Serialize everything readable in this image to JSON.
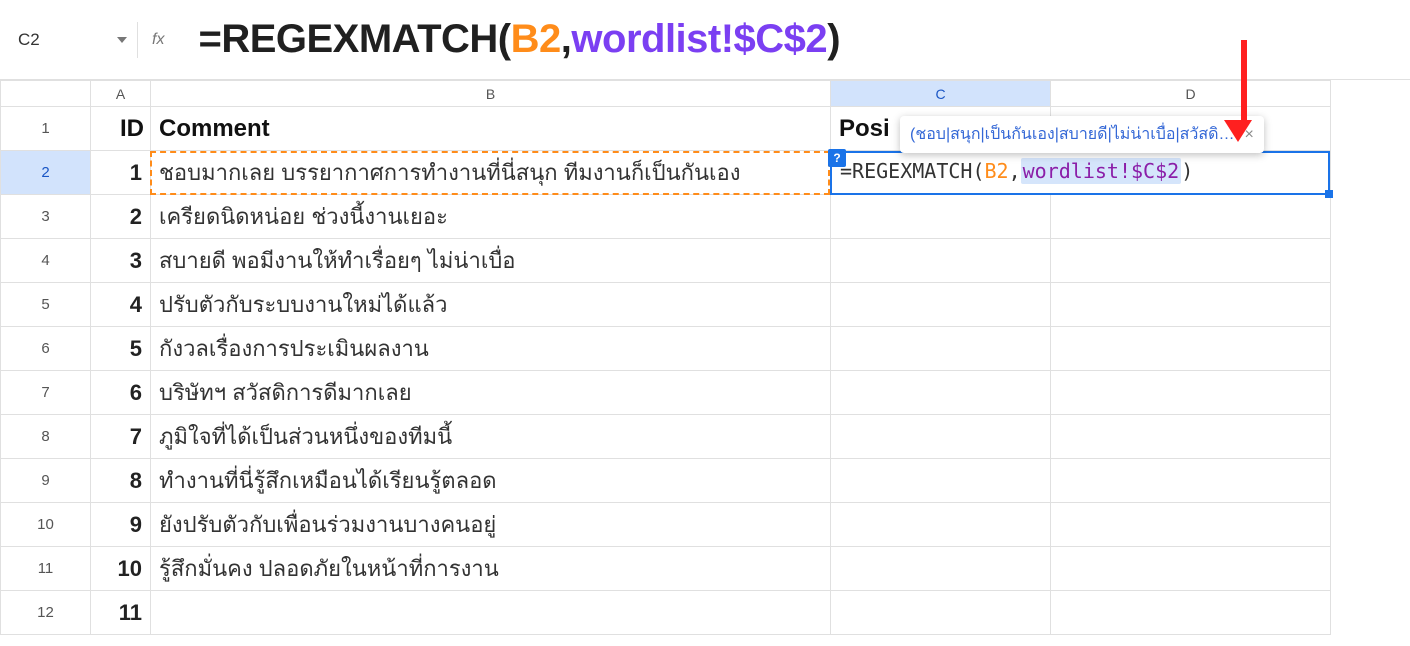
{
  "name_box": "C2",
  "formula_bar": {
    "eq": "=",
    "fn": "REGEXMATCH",
    "open": "(",
    "ref1": "B2",
    "comma": ",",
    "ref2": "wordlist!$C$2",
    "close": ")"
  },
  "columns": [
    "A",
    "B",
    "C",
    "D"
  ],
  "rows": [
    "1",
    "2",
    "3",
    "4",
    "5",
    "6",
    "7",
    "8",
    "9",
    "10",
    "11",
    "12"
  ],
  "headers": {
    "id": "ID",
    "comment": "Comment",
    "posi": "Posi"
  },
  "data": [
    {
      "id": "1",
      "comment": "ชอบมากเลย บรรยากาศการทำงานที่นี่สนุก ทีมงานก็เป็นกันเอง"
    },
    {
      "id": "2",
      "comment": "เครียดนิดหน่อย ช่วงนี้งานเยอะ"
    },
    {
      "id": "3",
      "comment": "สบายดี พอมีงานให้ทำเรื่อยๆ ไม่น่าเบื่อ"
    },
    {
      "id": "4",
      "comment": "ปรับตัวกับระบบงานใหม่ได้แล้ว"
    },
    {
      "id": "5",
      "comment": "กังวลเรื่องการประเมินผลงาน"
    },
    {
      "id": "6",
      "comment": "บริษัทฯ สวัสดิการดีมากเลย"
    },
    {
      "id": "7",
      "comment": "ภูมิใจที่ได้เป็นส่วนหนึ่งของทีมนี้"
    },
    {
      "id": "8",
      "comment": "ทำงานที่นี่รู้สึกเหมือนได้เรียนรู้ตลอด"
    },
    {
      "id": "9",
      "comment": "ยังปรับตัวกับเพื่อนร่วมงานบางคนอยู่"
    },
    {
      "id": "10",
      "comment": "รู้สึกมั่นคง ปลอดภัยในหน้าที่การงาน"
    },
    {
      "id": "11",
      "comment": ""
    }
  ],
  "active_formula": {
    "prefix": "=REGEXMATCH(",
    "ref1": "B2",
    "mid": ",",
    "ref2": "wordlist!$C$2",
    "suffix": ")"
  },
  "tooltip": {
    "text": "(ชอบ|สนุก|เป็นกันเอง|สบายดี|ไม่น่าเบื่อ|สวัสดิ…",
    "close": "×"
  },
  "help_badge": "?"
}
